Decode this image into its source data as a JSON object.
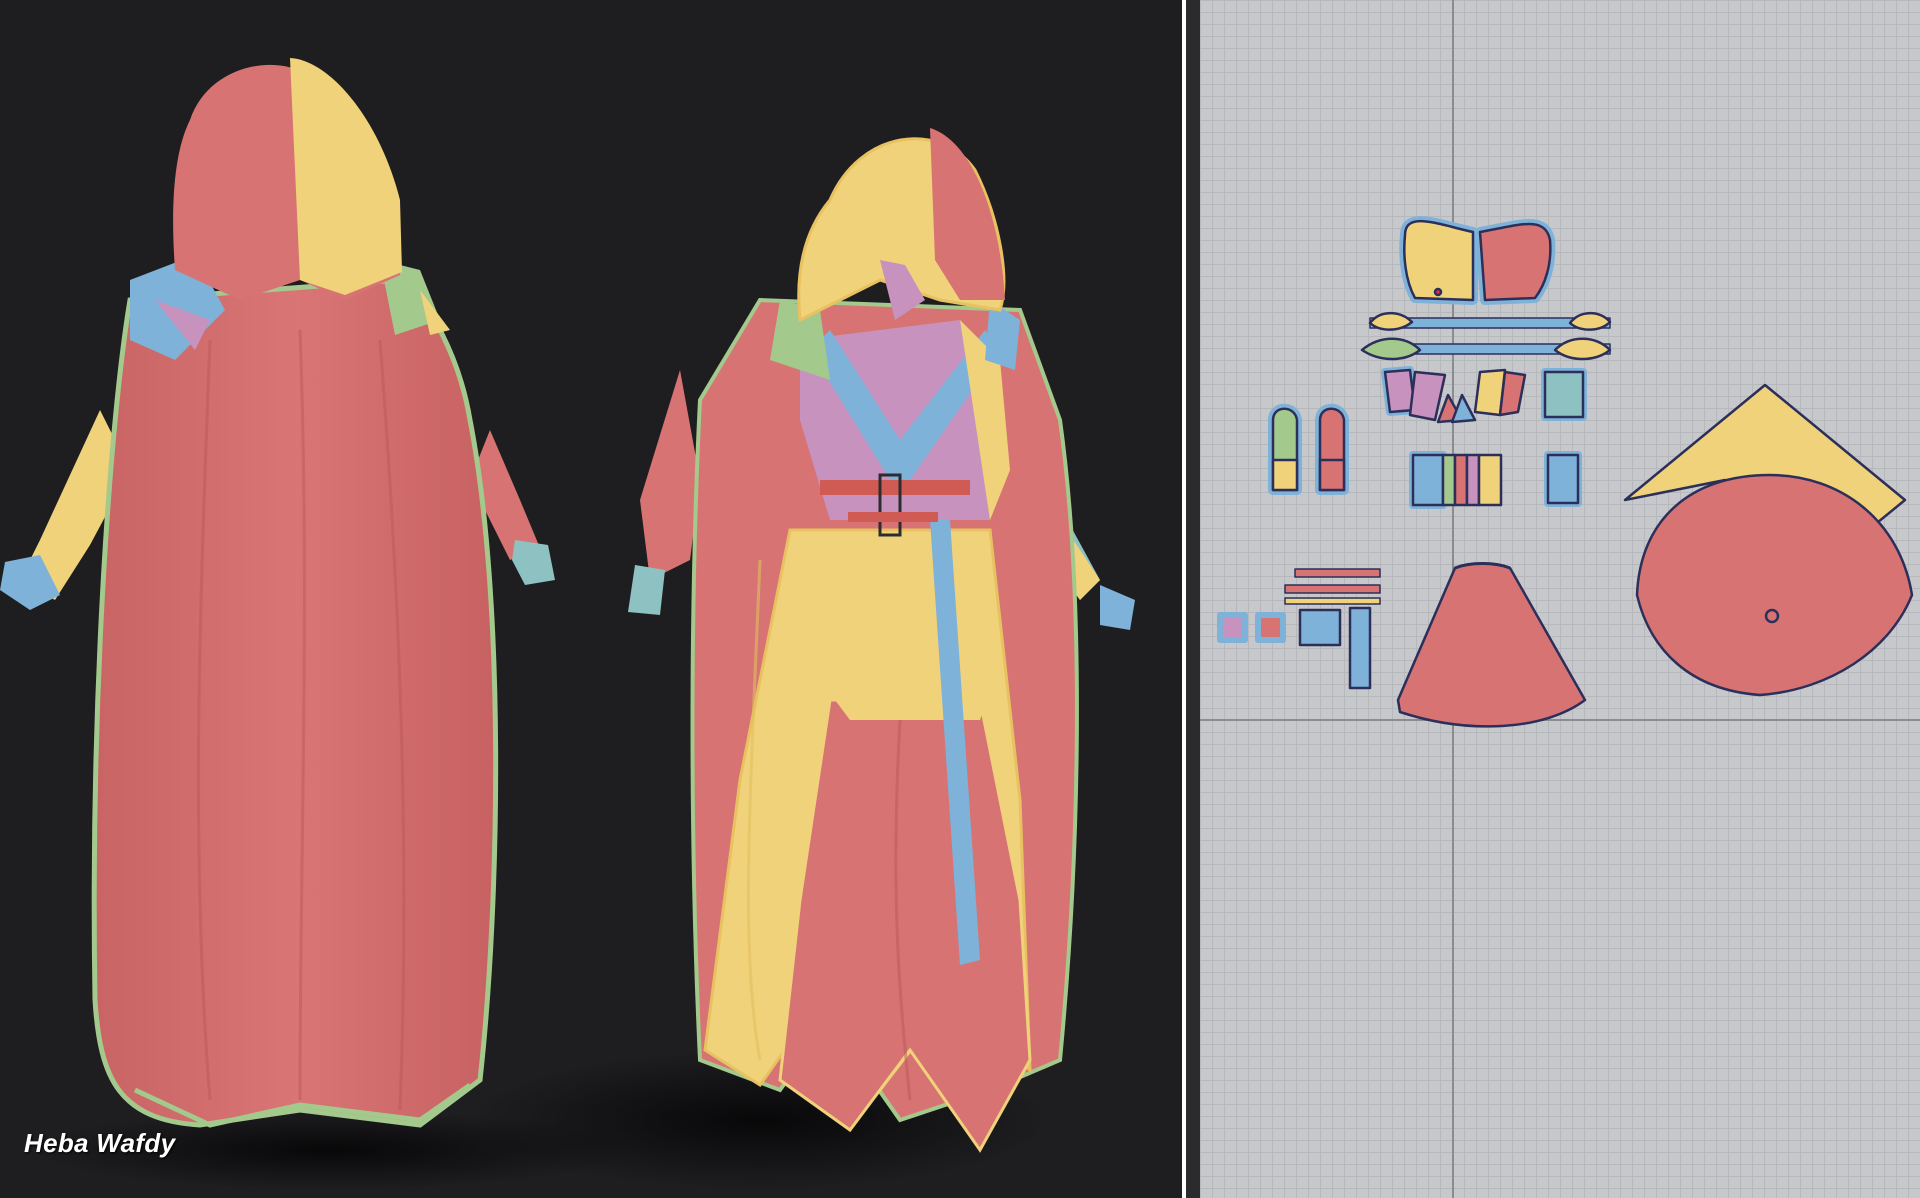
{
  "watermark": {
    "text": "Heba Wafdy"
  },
  "colors": {
    "red": "#d77473",
    "yellow": "#f0d27b",
    "blue": "#7eb2d9",
    "green": "#a4c98c",
    "teal": "#8ec1c1",
    "purple": "#c792bd",
    "outline": "#2b2f5a",
    "viewport_bg": "#1e1e21",
    "grid_bg": "#c7c8cb"
  },
  "viewport_3d": {
    "label": "3d-garment-view"
  },
  "viewport_2d": {
    "label": "2d-pattern-view"
  }
}
